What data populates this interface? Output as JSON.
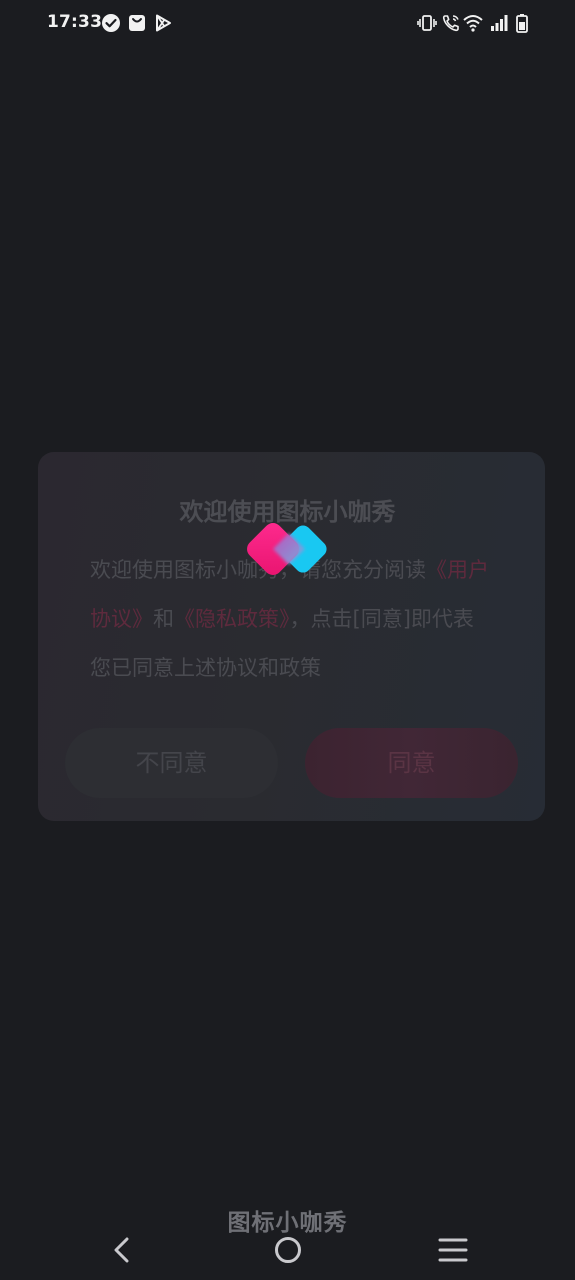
{
  "status_bar": {
    "time": "17:33",
    "left_icons": [
      "check-circle-icon",
      "shopping-bag-icon",
      "play-store-icon"
    ],
    "right_icons": [
      "vibrate-icon",
      "wifi-calling-icon",
      "wifi-icon",
      "signal-icon",
      "battery-icon"
    ]
  },
  "dialog": {
    "title": "欢迎使用图标小咖秀",
    "body_part1": "欢迎使用图标小咖秀，请您充分阅读",
    "user_agreement": "《用户协议》",
    "body_and": "和",
    "privacy_policy": "《隐私政策》",
    "body_part2": "，点击[同意]即代表您已同意上述协议和政策",
    "disagree_label": "不同意",
    "agree_label": "同意"
  },
  "app_name": "图标小咖秀",
  "nav_bar": {
    "back": "back-icon",
    "home": "home-icon",
    "recents": "menu-icon"
  },
  "colors": {
    "background": "#1b1c20",
    "logo_pink": "#ff1a8c",
    "logo_cyan": "#19c8f2"
  }
}
